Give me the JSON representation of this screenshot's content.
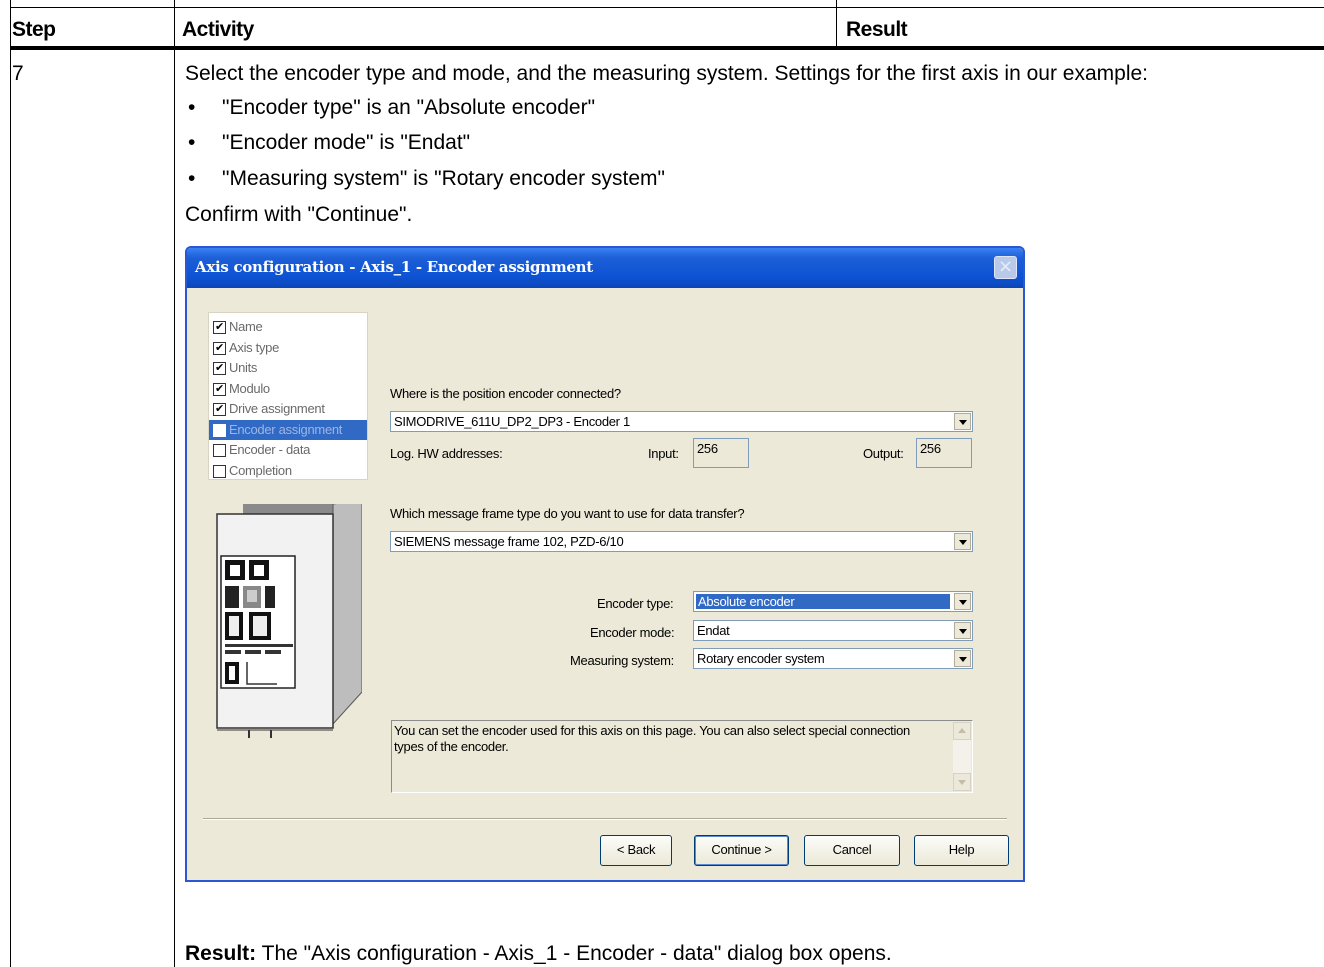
{
  "table": {
    "headers": {
      "step": "Step",
      "activity": "Activity",
      "result": "Result"
    },
    "row": {
      "step": "7",
      "intro": "Select the encoder type and mode, and the measuring system. Settings for the first axis in our example:",
      "bullets": [
        "\"Encoder type\" is an \"Absolute encoder\"",
        "\"Encoder mode\" is \"Endat\"",
        "\"Measuring system\" is \"Rotary encoder system\""
      ],
      "confirm": "Confirm with \"Continue\".",
      "result_label": "Result:",
      "result_text": "The \"Axis configuration - Axis_1 - Encoder - data\" dialog box opens."
    }
  },
  "dialog": {
    "title": "Axis configuration - Axis_1 - Encoder assignment",
    "close_glyph": "×",
    "steps": [
      {
        "label": "Name",
        "checked": true,
        "active": false
      },
      {
        "label": "Axis type",
        "checked": true,
        "active": false
      },
      {
        "label": "Units",
        "checked": true,
        "active": false
      },
      {
        "label": "Modulo",
        "checked": true,
        "active": false
      },
      {
        "label": "Drive assignment",
        "checked": true,
        "active": false
      },
      {
        "label": "Encoder assignment",
        "checked": false,
        "active": true
      },
      {
        "label": "Encoder - data",
        "checked": false,
        "active": false
      },
      {
        "label": "Completion",
        "checked": false,
        "active": false
      }
    ],
    "position_question": "Where is the position encoder connected?",
    "position_value": "SIMODRIVE_611U_DP2_DP3 - Encoder 1",
    "hw_label": "Log. HW addresses:",
    "input_label": "Input:",
    "input_value": "256",
    "output_label": "Output:",
    "output_value": "256",
    "frame_question": "Which message frame type do you want to use for data transfer?",
    "frame_value": "SIEMENS message frame 102, PZD-6/10",
    "encoder_type_label": "Encoder type:",
    "encoder_type_value": "Absolute encoder",
    "encoder_mode_label": "Encoder mode:",
    "encoder_mode_value": "Endat",
    "measuring_label": "Measuring system:",
    "measuring_value": "Rotary encoder system",
    "info_text": "You can set the encoder used for this axis on this page. You can also select special connection types of the encoder.",
    "buttons": {
      "back": "< Back",
      "continue": "Continue >",
      "cancel": "Cancel",
      "help": "Help"
    },
    "colors": {
      "titlebar": "#0e53d5",
      "selection": "#316ac5",
      "face": "#ece9d8"
    }
  }
}
